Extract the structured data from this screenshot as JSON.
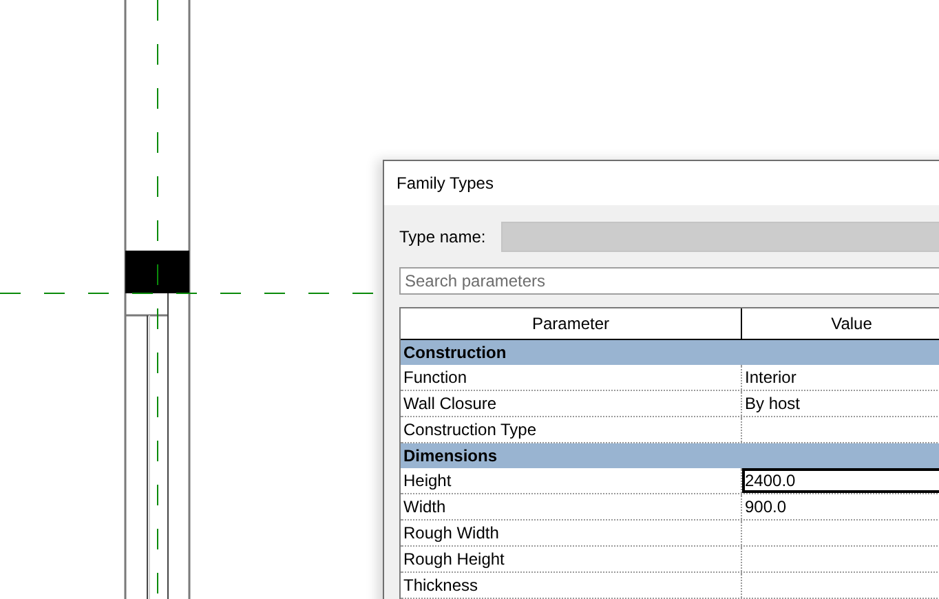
{
  "dialog": {
    "title": "Family Types",
    "type_name": {
      "label": "Type name:"
    },
    "search": {
      "placeholder": "Search parameters"
    },
    "table": {
      "columns": [
        "Parameter",
        "Value"
      ],
      "groups": [
        {
          "name": "Construction",
          "rows": [
            {
              "parameter": "Function",
              "value": "Interior",
              "focused": false
            },
            {
              "parameter": "Wall Closure",
              "value": "By host",
              "focused": false
            },
            {
              "parameter": "Construction Type",
              "focused": false
            }
          ]
        },
        {
          "name": "Dimensions",
          "rows": [
            {
              "parameter": "Height",
              "value": "2400.0",
              "focused": true
            },
            {
              "parameter": "Width",
              "value": "900.0",
              "focused": false
            },
            {
              "parameter": "Rough Width",
              "focused": false
            },
            {
              "parameter": "Rough Height",
              "focused": false
            },
            {
              "parameter": "Thickness",
              "focused": false
            }
          ]
        }
      ]
    }
  }
}
